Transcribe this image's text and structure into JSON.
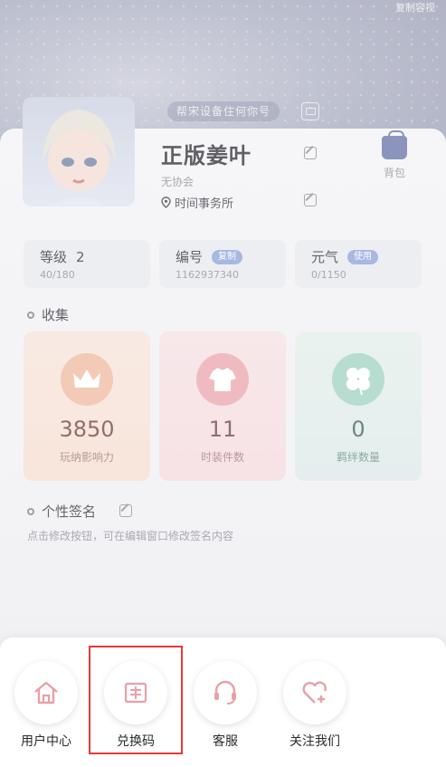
{
  "header": {
    "corner_text": "复制容视",
    "device_tip": "帮宋设备住何你号"
  },
  "profile": {
    "name": "正版姜叶",
    "guild": "无协会",
    "location": "时间事务所",
    "bag_label": "背包"
  },
  "stats": [
    {
      "title": "等级",
      "value_inline": "2",
      "sub": "40/180"
    },
    {
      "title": "编号",
      "badge": "复制",
      "sub": "1162937340"
    },
    {
      "title": "元气",
      "badge": "使用",
      "sub": "0/1150"
    }
  ],
  "collection": {
    "title": "收集",
    "cards": [
      {
        "value": "3850",
        "label": "玩纳影响力"
      },
      {
        "value": "11",
        "label": "时装件数"
      },
      {
        "value": "0",
        "label": "羁绊数量"
      }
    ]
  },
  "signature": {
    "title": "个性签名",
    "hint": "点击修改按钮，可在编辑窗口修改签名内容"
  },
  "actions": [
    {
      "label": "用户中心",
      "icon": "home-icon"
    },
    {
      "label": "兑换码",
      "icon": "ticket-icon"
    },
    {
      "label": "客服",
      "icon": "headset-icon"
    },
    {
      "label": "关注我们",
      "icon": "heart-plus-icon"
    }
  ],
  "colors": {
    "highlight": "#e33a3a",
    "accent": "#8aa0d8",
    "pink": "#e8a0a8"
  }
}
